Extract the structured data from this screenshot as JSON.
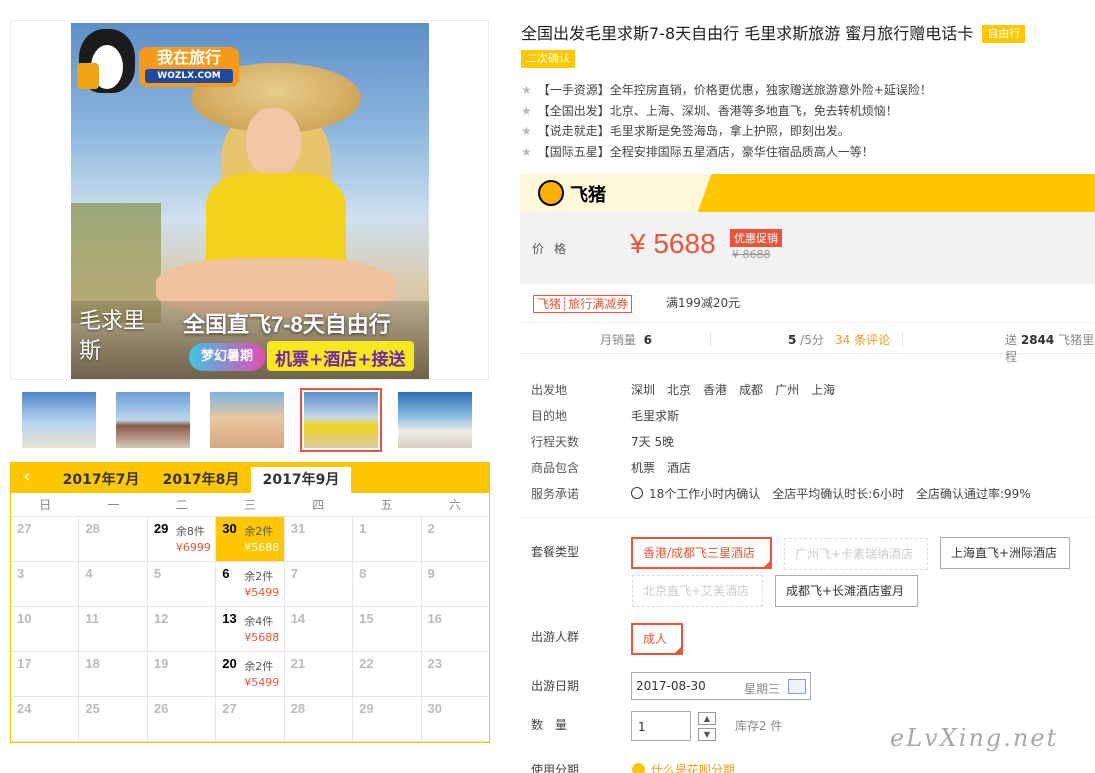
{
  "gallery": {
    "logo_text": "我在旅行",
    "logo_domain": "WOZLX.COM",
    "banner_title": "全国直飞7-8天自由行",
    "banner_dream": "梦幻暑期",
    "banner_sub": "机票+酒店+接送",
    "calligraphy": "毛求里斯",
    "thumbnails": 5,
    "active_thumbnail": 4
  },
  "calendar": {
    "tabs": [
      "2017年7月",
      "2017年8月",
      "2017年9月"
    ],
    "active_tab": 2,
    "weekdays": [
      "日",
      "一",
      "二",
      "三",
      "四",
      "五",
      "六"
    ],
    "weeks": [
      [
        {
          "d": "27"
        },
        {
          "d": "28"
        },
        {
          "d": "29",
          "stock": "余8件",
          "price": "¥6999"
        },
        {
          "d": "30",
          "stock": "余2件",
          "price": "¥5688",
          "sel": true
        },
        {
          "d": "31"
        },
        {
          "d": "1"
        },
        {
          "d": "2"
        }
      ],
      [
        {
          "d": "3"
        },
        {
          "d": "4"
        },
        {
          "d": "5"
        },
        {
          "d": "6",
          "stock": "余2件",
          "price": "¥5499"
        },
        {
          "d": "7"
        },
        {
          "d": "8"
        },
        {
          "d": "9"
        }
      ],
      [
        {
          "d": "10"
        },
        {
          "d": "11"
        },
        {
          "d": "12"
        },
        {
          "d": "13",
          "stock": "余4件",
          "price": "¥5688"
        },
        {
          "d": "14"
        },
        {
          "d": "15"
        },
        {
          "d": "16"
        }
      ],
      [
        {
          "d": "17"
        },
        {
          "d": "18"
        },
        {
          "d": "19"
        },
        {
          "d": "20",
          "stock": "余2件",
          "price": "¥5499"
        },
        {
          "d": "21"
        },
        {
          "d": "22"
        },
        {
          "d": "23"
        }
      ],
      [
        {
          "d": "24"
        },
        {
          "d": "25"
        },
        {
          "d": "26"
        },
        {
          "d": "27"
        },
        {
          "d": "28"
        },
        {
          "d": "29"
        },
        {
          "d": "30"
        }
      ]
    ]
  },
  "product": {
    "title": "全国出发毛里求斯7-8天自由行 毛里求斯旅游 蜜月旅行赠电话卡",
    "tag_free": "自由行",
    "tag_confirm": "二次确认",
    "features": [
      "【一手资源】全年控房直销，价格更优惠，独家赠送旅游意外险+延误险！",
      "【全国出发】北京、上海、深圳、香港等多地直飞，免去转机烦恼！",
      "【说走就走】毛里求斯是免签海岛，拿上护照，即刻出发。",
      "【国际五星】全程安排国际五星酒店，豪华住宿品质高人一等！"
    ]
  },
  "price": {
    "brand": "飞猪",
    "label": "价格",
    "value": "¥ 5688",
    "promo": "优惠促销",
    "original": "¥ 8688"
  },
  "coupon": {
    "tag": "飞猪┊旅行满减券",
    "desc": "满199减20元"
  },
  "stats": {
    "monthly_label": "月销量",
    "monthly_value": "6",
    "score": "5",
    "score_suffix": " /5分",
    "reviews": "34 条评论",
    "send_prefix": "送",
    "points": "2844",
    "points_suffix": " 飞猪里程"
  },
  "info": [
    {
      "k": "出发地",
      "v": [
        "深圳",
        "北京",
        "香港",
        "成都",
        "广州",
        "上海"
      ]
    },
    {
      "k": "目的地",
      "v": [
        "毛里求斯"
      ]
    },
    {
      "k": "行程天数",
      "v": [
        "7天 5晚"
      ]
    },
    {
      "k": "商品包含",
      "v": [
        "机票",
        "酒店"
      ]
    },
    {
      "k": "服务承诺",
      "v": [
        "18个工作小时内确认",
        "全店平均确认时长:6小时",
        "全店确认通过率:99%"
      ]
    }
  ],
  "options": {
    "package_label": "套餐类型",
    "packages": [
      "香港/成都飞三星酒店",
      "广州飞+卡素瑞纳酒店",
      "上海直飞+洲际酒店",
      "北京直飞+艾美酒店",
      "成都飞+长滩酒店蜜月"
    ],
    "people_label": "出游人群",
    "people": "成人",
    "date_label": "出游日期",
    "date_value": "2017-08-30",
    "date_weekday": "星期三",
    "qty_label": "数量",
    "qty_value": "1",
    "stock": "库存2 件",
    "installment_label": "使用分期",
    "installment_link": "什么是花呗分期"
  },
  "watermark": "eLvXing.net",
  "colors": {
    "accent": "#ffc700",
    "price": "#e8553a",
    "orange": "#f59a1a"
  }
}
